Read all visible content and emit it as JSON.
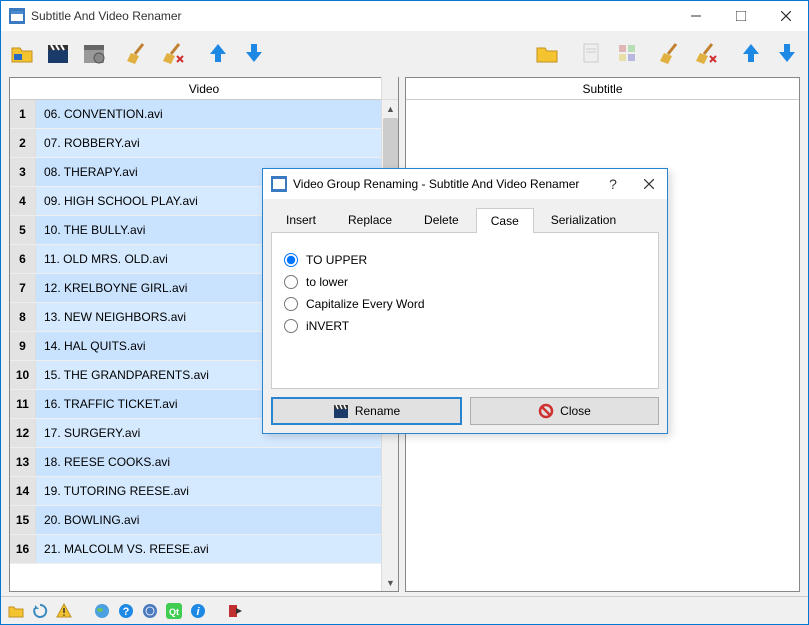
{
  "window": {
    "title": "Subtitle And Video Renamer"
  },
  "panes": {
    "video_header": "Video",
    "subtitle_header": "Subtitle"
  },
  "video_rows": [
    {
      "n": "1",
      "name": "06. CONVENTION.avi"
    },
    {
      "n": "2",
      "name": "07. ROBBERY.avi"
    },
    {
      "n": "3",
      "name": "08. THERAPY.avi"
    },
    {
      "n": "4",
      "name": "09. HIGH SCHOOL PLAY.avi"
    },
    {
      "n": "5",
      "name": "10. THE BULLY.avi"
    },
    {
      "n": "6",
      "name": "11. OLD MRS. OLD.avi"
    },
    {
      "n": "7",
      "name": "12. KRELBOYNE GIRL.avi"
    },
    {
      "n": "8",
      "name": "13. NEW NEIGHBORS.avi"
    },
    {
      "n": "9",
      "name": "14. HAL QUITS.avi"
    },
    {
      "n": "10",
      "name": "15. THE GRANDPARENTS.avi"
    },
    {
      "n": "11",
      "name": "16. TRAFFIC TICKET.avi"
    },
    {
      "n": "12",
      "name": "17. SURGERY.avi"
    },
    {
      "n": "13",
      "name": "18. REESE COOKS.avi"
    },
    {
      "n": "14",
      "name": "19. TUTORING REESE.avi"
    },
    {
      "n": "15",
      "name": "20. BOWLING.avi"
    },
    {
      "n": "16",
      "name": "21. MALCOLM VS. REESE.avi"
    }
  ],
  "dialog": {
    "title": "Video Group Renaming - Subtitle And Video Renamer",
    "tabs": {
      "insert": "Insert",
      "replace": "Replace",
      "delete": "Delete",
      "case": "Case",
      "serial": "Serialization"
    },
    "options": {
      "upper": "TO UPPER",
      "lower": "to lower",
      "cap": "Capitalize Every Word",
      "invert": "iNVERT"
    },
    "rename": "Rename",
    "close": "Close"
  }
}
